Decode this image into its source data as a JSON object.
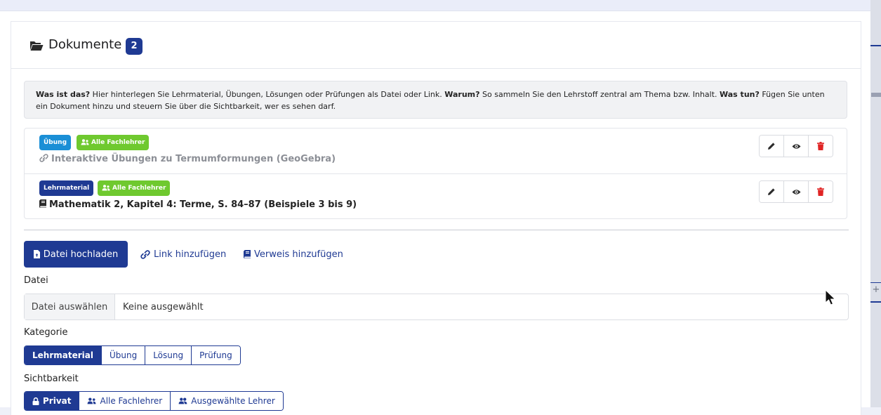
{
  "card": {
    "title": "Dokumente",
    "count": "2"
  },
  "info": {
    "q1": "Was ist das?",
    "t1": " Hier hinterlegen Sie Lehrmaterial, Übungen, Lösungen oder Prüfungen als Datei oder Link. ",
    "q2": "Warum?",
    "t2": " So sammeln Sie den Lehrstoff zentral am Thema bzw. Inhalt. ",
    "q3": "Was tun?",
    "t3": " Fügen Sie unten ein Dokument hinzu und steuern Sie über die Sichtbarkeit, wer es sehen darf."
  },
  "documents": [
    {
      "category": "Übung",
      "visibility": "Alle Fachlehrer",
      "title": "Interaktive Übungen zu Termumformungen (GeoGebra)",
      "type_icon": "link-icon"
    },
    {
      "category": "Lehrmaterial",
      "visibility": "Alle Fachlehrer",
      "title": "Mathematik 2, Kapitel 4: Terme, S. 84–87 (Beispiele 3 bis 9)",
      "type_icon": "book-icon"
    }
  ],
  "tabs": {
    "upload": "Datei hochladen",
    "link": "Link hinzufügen",
    "reference": "Verweis hinzufügen"
  },
  "file": {
    "label": "Datei",
    "button": "Datei auswählen",
    "value": "Keine ausgewählt"
  },
  "category": {
    "label": "Kategorie",
    "options": [
      "Lehrmaterial",
      "Übung",
      "Lösung",
      "Prüfung"
    ],
    "selected": "Lehrmaterial"
  },
  "visibility": {
    "label": "Sichtbarkeit",
    "options": [
      "Privat",
      "Alle Fachlehrer",
      "Ausgewählte Lehrer"
    ],
    "selected": "Privat"
  },
  "colors": {
    "primary": "#1f3a93",
    "badge_uebung": "#1a8fd6",
    "badge_alle": "#6fc92f",
    "delete": "#e02424"
  }
}
